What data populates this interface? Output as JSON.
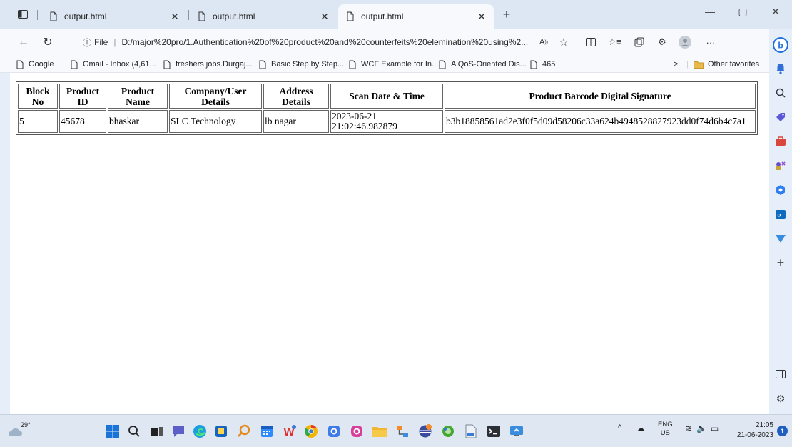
{
  "tabs": [
    {
      "label": "output.html",
      "active": false
    },
    {
      "label": "output.html",
      "active": false
    },
    {
      "label": "output.html",
      "active": true
    }
  ],
  "new_tab_label": "+",
  "address": {
    "file_label": "File",
    "url": "D:/major%20pro/1.Authentication%20of%20product%20and%20counterfeits%20elemination%20using%2..."
  },
  "favorites": [
    {
      "label": "Google",
      "icon": "page-icon"
    },
    {
      "label": "Gmail - Inbox (4,61...",
      "icon": "page-icon"
    },
    {
      "label": "freshers jobs.Durgaj...",
      "icon": "page-icon"
    },
    {
      "label": "Basic Step by Step...",
      "icon": "page-icon"
    },
    {
      "label": "WCF Example for In...",
      "icon": "page-icon"
    },
    {
      "label": "A QoS-Oriented Dis...",
      "icon": "page-icon"
    },
    {
      "label": "465",
      "icon": "page-icon"
    }
  ],
  "other_favorites": "Other favorites",
  "table": {
    "headers": [
      "Block\nNo",
      "Product\nID",
      "Product\nName",
      "Company/User\nDetails",
      "Address\nDetails",
      "Scan Date & Time",
      "Product Barcode Digital Signature"
    ],
    "rows": [
      [
        "5",
        "45678",
        "bhaskar",
        "SLC Technology",
        "lb nagar",
        "2023-06-21\n21:02:46.982879",
        "b3b18858561ad2e3f0f5d09d58206c33a624b4948528827923dd0f74d6b4c7a1"
      ]
    ]
  },
  "taskbar": {
    "weather_temp": "29°",
    "lang_top": "ENG",
    "lang_bottom": "US",
    "time": "21:05",
    "date": "21-06-2023",
    "notification_count": "1"
  },
  "colors": {
    "accent": "#1f5fbf",
    "folder": "#e8b84a"
  }
}
